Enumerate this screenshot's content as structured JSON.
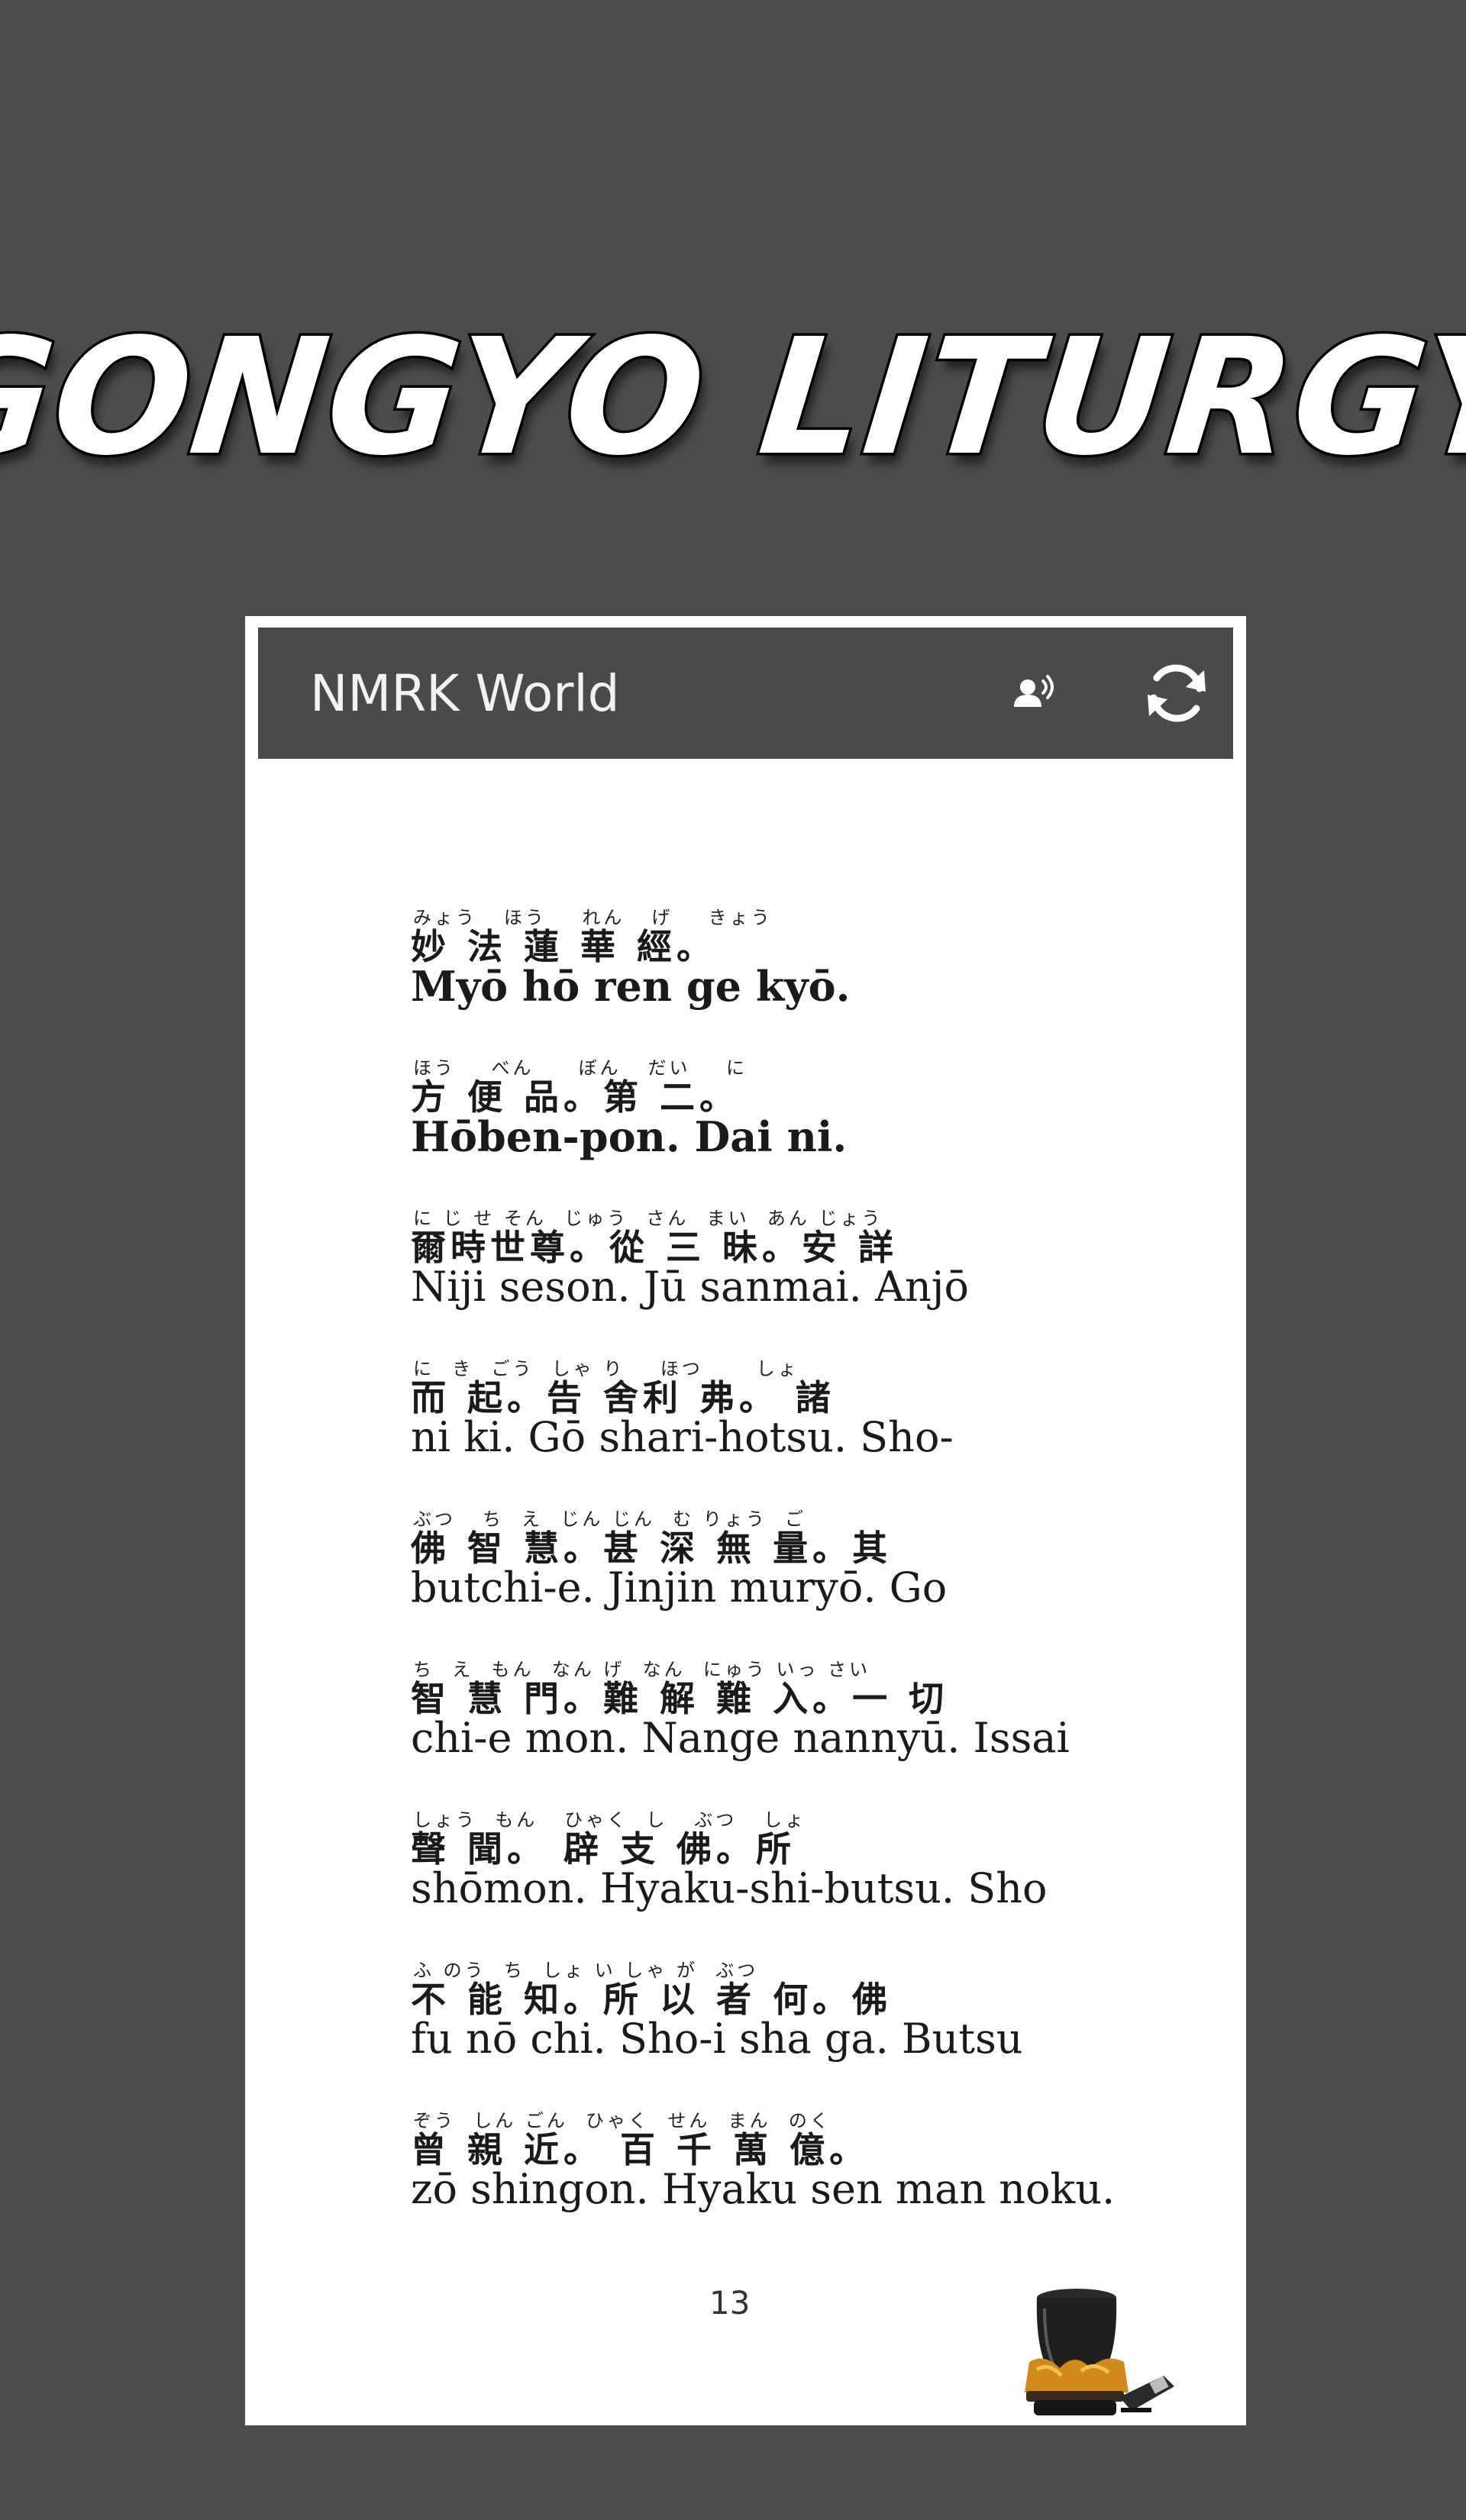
{
  "banner": {
    "title": "GONGYO LITURGY"
  },
  "app_bar": {
    "title": "NMRK World",
    "voice_icon": "voice-speaker-icon",
    "refresh_icon": "refresh-icon"
  },
  "book": {
    "verses": [
      {
        "furigana": "みょう   ほう    れん   げ    きょう",
        "kanji": "妙 法 蓮 華 經。",
        "romaji": "Myō hō ren ge kyō.",
        "bold": true
      },
      {
        "furigana": "ほう    べん     ぼん   だい    に",
        "kanji": "方 便 品。第 二。",
        "romaji": "Hōben-pon. Dai ni.",
        "bold": true
      },
      {
        "furigana": "に じ せ そん  じゅう  さん  まい  あん じょう",
        "kanji": "爾時世尊。從 三 昧。安 詳",
        "romaji": "Niji seson. Jū sanmai. Anjō",
        "bold": false
      },
      {
        "furigana": "に  き  ごう  しゃ り    ほつ      しょ",
        "kanji": "而 起。告 舍利 弗。 諸",
        "romaji": "ni ki. Gō shari-hotsu. Sho-",
        "bold": false
      },
      {
        "furigana": "ぶつ   ち  え  じん じん  む りょう  ご",
        "kanji": "佛 智 慧。甚 深 無 量。其",
        "romaji": "butchi-e. Jinjin muryō. Go",
        "bold": false
      },
      {
        "furigana": "ち  え  もん  なん げ  なん  にゅう いっ さい",
        "kanji": "智 慧 門。難 解 難 入。一 切",
        "romaji": "chi-e mon. Nange nannyū. Issai",
        "bold": false
      },
      {
        "furigana": "しょう  もん   ひゃく  し   ぶつ   しょ",
        "kanji": "聲 聞。 辟 支 佛。所",
        "romaji": "shōmon. Hyaku-shi-butsu. Sho",
        "bold": false
      },
      {
        "furigana": "ふ のう  ち  しょ い しゃ が  ぶつ",
        "kanji": "不 能 知。所 以 者 何。佛",
        "romaji": "fu nō chi. Sho-i sha ga. Butsu",
        "bold": false
      },
      {
        "furigana": "ぞう  しん ごん  ひゃく  せん  まん  のく",
        "kanji": "曾 親 近。 百 千 萬 億。",
        "romaji": "zō shingon. Hyaku sen man noku.",
        "bold": false
      }
    ],
    "page_number": "13"
  },
  "colors": {
    "background": "#4d4d4d",
    "app_bar": "#4a4a4a",
    "page": "#ffffff",
    "text": "#1a1a1a"
  }
}
